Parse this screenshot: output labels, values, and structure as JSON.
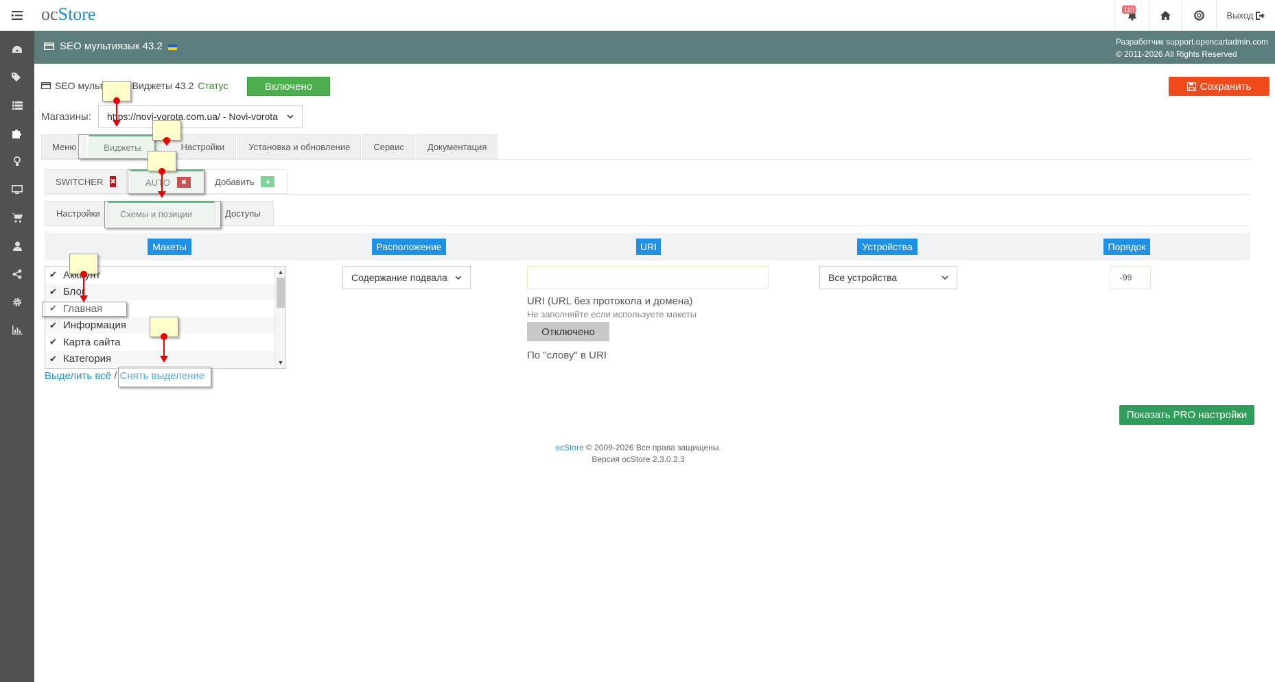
{
  "header": {
    "logo_prefix": "oc",
    "logo_main": "Store",
    "notifications_count": "110",
    "logout_label": "Выход"
  },
  "band": {
    "title": "SEO мультиязык 43.2",
    "developer": "Разработчик support.opencartadmin.com",
    "copyright": "© 2011-2026 All Rights Reserved"
  },
  "status_line": {
    "module_title": "SEO мультиязык Виджеты 43.2",
    "status_label": "Статус",
    "status_button": "Включено"
  },
  "save_label": "Сохранить",
  "stores": {
    "label": "Магазины:",
    "value": "https://novi-vorota.com.ua/ - Novi-vorota"
  },
  "main_tabs": [
    "Меню",
    "Виджеты",
    "Настройки",
    "Установка и обновление",
    "Сервис",
    "Документация"
  ],
  "widget_tabs": {
    "switcher": "SWITCHER",
    "auto": "AUTO",
    "add": "Добавить"
  },
  "sub_tabs": [
    "Настройки",
    "Схемы и позиции",
    "Доступы"
  ],
  "columns": [
    "Макеты",
    "Расположение",
    "URI",
    "Устройства",
    "Порядок"
  ],
  "layouts": [
    "Аккаунт",
    "Блог",
    "Главная",
    "Информация",
    "Карта сайта",
    "Категория"
  ],
  "select_all": "Выделить всё",
  "separator": "/",
  "deselect": "Снять выделение",
  "position_value": "Содержание подвала",
  "uri": {
    "label": "URI (URL без протокола и домена)",
    "help": "Не заполняйте если используете макеты",
    "toggle": "Отключено",
    "word_label": "По \"слову\" в URI"
  },
  "devices_value": "Все устройства",
  "order_value": "-99",
  "pro_button": "Показать PRO настройки",
  "footer": {
    "brand": "ocStore",
    "rights": " © 2009-2026 Все права защищены.",
    "version": "Версия ocStore 2.3.0.2.3"
  },
  "colors": {
    "accent": "#1e91cf",
    "header_band": "#5b7e7d",
    "save": "#f24b1b",
    "enabled": "#4cae4c",
    "pro": "#2e9e5a"
  }
}
